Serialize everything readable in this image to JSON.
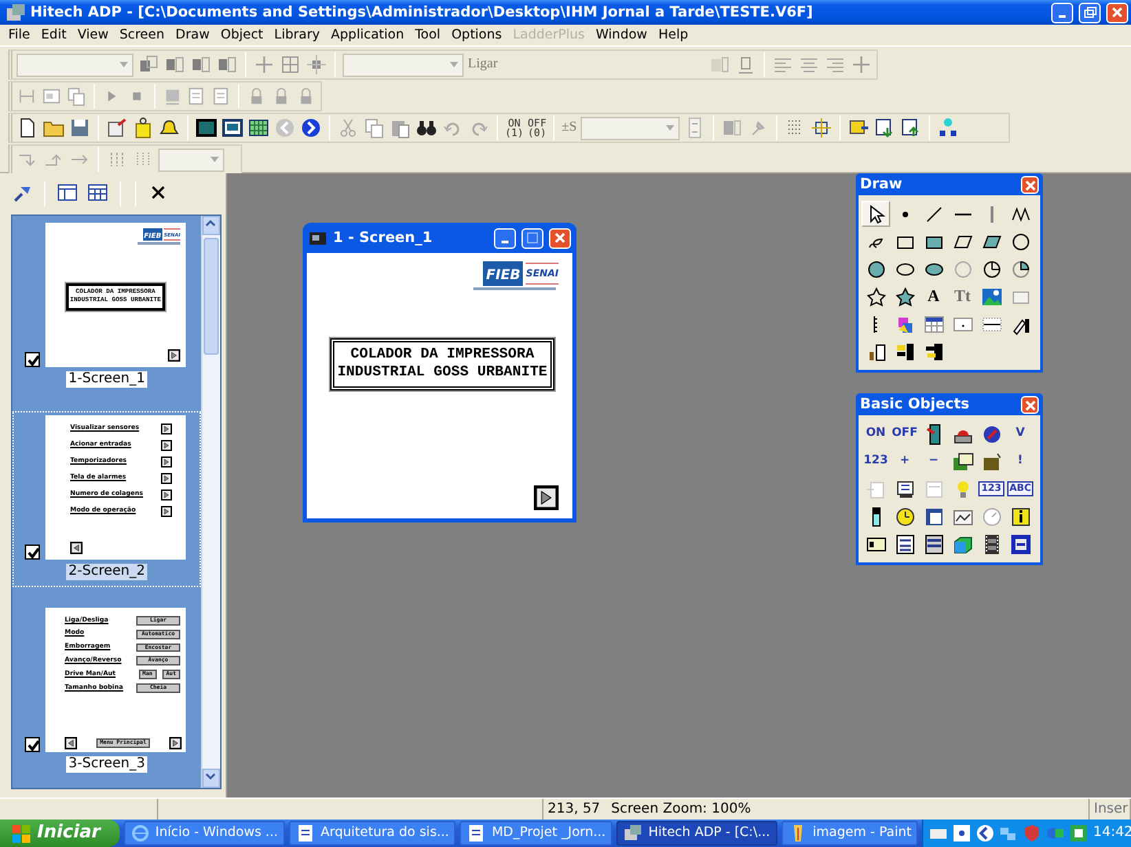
{
  "window": {
    "title": "Hitech ADP - [C:\\Documents and Settings\\Administrador\\Desktop\\IHM Jornal a Tarde\\TESTE.V6F]"
  },
  "menu": [
    {
      "label": "File",
      "disabled": false
    },
    {
      "label": "Edit",
      "disabled": false
    },
    {
      "label": "View",
      "disabled": false
    },
    {
      "label": "Screen",
      "disabled": false
    },
    {
      "label": "Draw",
      "disabled": false
    },
    {
      "label": "Object",
      "disabled": false
    },
    {
      "label": "Library",
      "disabled": false
    },
    {
      "label": "Application",
      "disabled": false
    },
    {
      "label": "Tool",
      "disabled": false
    },
    {
      "label": "Options",
      "disabled": false
    },
    {
      "label": "LadderPlus",
      "disabled": true
    },
    {
      "label": "Window",
      "disabled": false
    },
    {
      "label": "Help",
      "disabled": false
    }
  ],
  "toolbar": {
    "state_text": "Ligar",
    "on_label": [
      "ON",
      "(1)"
    ],
    "off_label": [
      "OFF",
      "(0)"
    ],
    "set_label": "±S"
  },
  "screens": [
    {
      "kind": "title",
      "label": "1-Screen_1",
      "checked": true,
      "selected": false,
      "logo": [
        "FIEB",
        "SENAI"
      ],
      "lines": [
        "COLADOR DA IMPRESSORA",
        "INDUSTRIAL GOSS URBANITE"
      ]
    },
    {
      "kind": "menu",
      "label": "2-Screen_2",
      "checked": true,
      "selected": true,
      "items": [
        "Visualizar sensores",
        "Acionar entradas",
        "Temporizadores",
        "Tela de alarmes",
        "Numero de colagens",
        "Modo de operação"
      ]
    },
    {
      "kind": "controls",
      "label": "3-Screen_3",
      "checked": true,
      "selected": false,
      "rows": [
        {
          "label": "Liga/Desliga",
          "buttons": [
            "Ligar"
          ]
        },
        {
          "label": "Modo",
          "buttons": [
            "Automatico"
          ]
        },
        {
          "label": "Emborragem",
          "buttons": [
            "Encostar"
          ]
        },
        {
          "label": "Avanço/Reverso",
          "buttons": [
            "Avanço"
          ]
        },
        {
          "label": "Drive Man/Aut",
          "buttons": [
            "Man",
            "Aut"
          ]
        },
        {
          "label": "Tamanho bobina",
          "buttons": [
            "Cheia"
          ]
        }
      ],
      "footer_button": "Menu Principal"
    }
  ],
  "screen_window": {
    "title": "1 - Screen_1",
    "logo": [
      "FIEB",
      "SENAI"
    ],
    "lines": [
      "COLADOR DA IMPRESSORA",
      "INDUSTRIAL GOSS URBANITE"
    ]
  },
  "draw_palette": {
    "title": "Draw",
    "tools": [
      {
        "selected": true
      },
      {
        "selected": false
      },
      {
        "selected": false
      },
      {
        "selected": false
      },
      {
        "selected": false
      },
      {
        "selected": false
      },
      {
        "selected": false
      },
      {
        "selected": false
      },
      {
        "selected": false
      },
      {
        "selected": false
      },
      {
        "selected": false
      },
      {
        "selected": false
      },
      {
        "selected": false
      },
      {
        "selected": false
      },
      {
        "selected": false
      },
      {
        "selected": false
      },
      {
        "selected": false
      },
      {
        "selected": false
      },
      {
        "selected": false
      },
      {
        "selected": false
      },
      {
        "selected": false,
        "label": "A"
      },
      {
        "selected": false,
        "label": "Tt"
      },
      {
        "selected": false
      },
      {
        "selected": false
      },
      {
        "selected": false
      },
      {
        "selected": false
      },
      {
        "selected": false
      },
      {
        "selected": false
      },
      {
        "selected": false
      },
      {
        "selected": false
      },
      {
        "selected": false
      },
      {
        "selected": false
      },
      {
        "selected": false
      }
    ]
  },
  "basic_objects": {
    "title": "Basic Objects",
    "items": [
      {
        "kind": "text",
        "label": "ON"
      },
      {
        "kind": "text",
        "label": "OFF"
      },
      {
        "kind": "icon"
      },
      {
        "kind": "icon"
      },
      {
        "kind": "icon"
      },
      {
        "kind": "text",
        "label": "V"
      },
      {
        "kind": "text",
        "label": "123"
      },
      {
        "kind": "text",
        "label": "+"
      },
      {
        "kind": "text",
        "label": "−"
      },
      {
        "kind": "icon"
      },
      {
        "kind": "icon"
      },
      {
        "kind": "text",
        "label": "!"
      },
      {
        "kind": "icon"
      },
      {
        "kind": "icon"
      },
      {
        "kind": "icon"
      },
      {
        "kind": "icon"
      },
      {
        "kind": "boxed",
        "label": "123"
      },
      {
        "kind": "boxed",
        "label": "ABC"
      },
      {
        "kind": "icon"
      },
      {
        "kind": "icon"
      },
      {
        "kind": "icon"
      },
      {
        "kind": "icon"
      },
      {
        "kind": "icon"
      },
      {
        "kind": "icon"
      },
      {
        "kind": "icon"
      },
      {
        "kind": "icon"
      },
      {
        "kind": "icon"
      },
      {
        "kind": "icon"
      },
      {
        "kind": "icon"
      },
      {
        "kind": "icon"
      }
    ]
  },
  "status_bar": {
    "position": "213, 57",
    "zoom": "Screen Zoom: 100%",
    "mode": "Inser"
  },
  "taskbar": {
    "start": "Iniciar",
    "tasks": [
      {
        "label": "Início - Windows ...",
        "selected": false
      },
      {
        "label": "Arquitetura do sis...",
        "selected": false
      },
      {
        "label": "MD_Projet _Jorn...",
        "selected": false
      },
      {
        "label": "Hitech ADP - [C:\\...",
        "selected": true
      },
      {
        "label": "imagem - Paint",
        "selected": false
      }
    ],
    "clock": "14:42"
  }
}
